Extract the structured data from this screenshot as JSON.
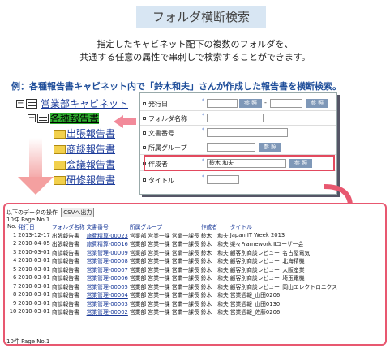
{
  "title": "フォルダ横断検索",
  "description": {
    "line1": "指定したキャビネット配下の複数のフォルダを、",
    "line2": "共通する任意の属性で串刺しで検索することができます。"
  },
  "example": "例：各種報告書キャビネット内で「鈴木和夫」さんが作成した報告書を横断検索。",
  "tree": {
    "cabinet": "営業部キャビネット",
    "folder": "各種報告書",
    "children": [
      "出張報告書",
      "商談報告書",
      "会議報告書",
      "研修報告書"
    ]
  },
  "form": {
    "issue_date_label": "発行日",
    "date_separator": "-",
    "ref_label": "参 照",
    "folder_name_label": "フォルダ名称",
    "doc_no_label": "文書番号",
    "group_label": "所属グループ",
    "author_label": "作成者",
    "author_value": "鈴木 和夫",
    "title_label": "タイトル",
    "required_mark": "*"
  },
  "result": {
    "operation_label": "以下のデータの操作",
    "csv_button": "CSVへ出力",
    "count_top": "10件 Page No.1",
    "count_bottom": "10件 Page No.1",
    "headers": [
      "No.",
      "発行日",
      "フォルダ名称",
      "文書番号",
      "所属グループ",
      "作成者",
      "タイトル"
    ],
    "rows": [
      [
        "1",
        "2013-12-17",
        "出張報告書",
        "旅費精算-00023",
        "営業部 営業一課 営業一課長",
        "鈴木　和夫",
        "Japan IT Week 2013"
      ],
      [
        "2",
        "2010-04-05",
        "出張報告書",
        "旅費精算-00016",
        "営業部 営業一課 営業一課長",
        "鈴木　和夫",
        "楽々Framework Ⅱユーザ一会"
      ],
      [
        "3",
        "2010-03-01",
        "商談報告書",
        "営業管理-00009",
        "営業部 営業一課 営業一課長",
        "鈴木　和夫",
        "顧客別商談レビュー_名古屋電気"
      ],
      [
        "4",
        "2010-03-01",
        "商談報告書",
        "営業管理-00008",
        "営業部 営業一課 営業一課長",
        "鈴木　和夫",
        "顧客別商談レビュー_北海精機"
      ],
      [
        "5",
        "2010-03-01",
        "商談報告書",
        "営業管理-00007",
        "営業部 営業一課 営業一課長",
        "鈴木　和夫",
        "顧客別商談レビュー_大阪産業"
      ],
      [
        "6",
        "2010-03-01",
        "商談報告書",
        "営業管理-00006",
        "営業部 営業一課 営業一課長",
        "鈴木　和夫",
        "顧客別商談レビュー_埼玉電機"
      ],
      [
        "7",
        "2010-03-01",
        "商談報告書",
        "営業管理-00005",
        "営業部 営業一課 営業一課長",
        "鈴木　和夫",
        "顧客別商談レビュー_岡山エレクトロニクス"
      ],
      [
        "8",
        "2010-03-01",
        "商談報告書",
        "営業管理-00004",
        "営業部 営業一課 営業一課長",
        "鈴木　和夫",
        "営業週報_山田0206"
      ],
      [
        "9",
        "2010-03-01",
        "商談報告書",
        "営業管理-00003",
        "営業部 営業一課 営業一課長",
        "鈴木　和夫",
        "営業週報_山田0130"
      ],
      [
        "10",
        "2010-03-01",
        "商談報告書",
        "営業管理-00002",
        "営業部 営業一課 営業一課長",
        "鈴木　和夫",
        "営業週報_佐藤0206"
      ]
    ]
  },
  "colors": {
    "accent_red": "#e85870",
    "link_blue": "#1a3a99",
    "button_blue": "#7f98b8",
    "selected_green": "#30b030"
  }
}
